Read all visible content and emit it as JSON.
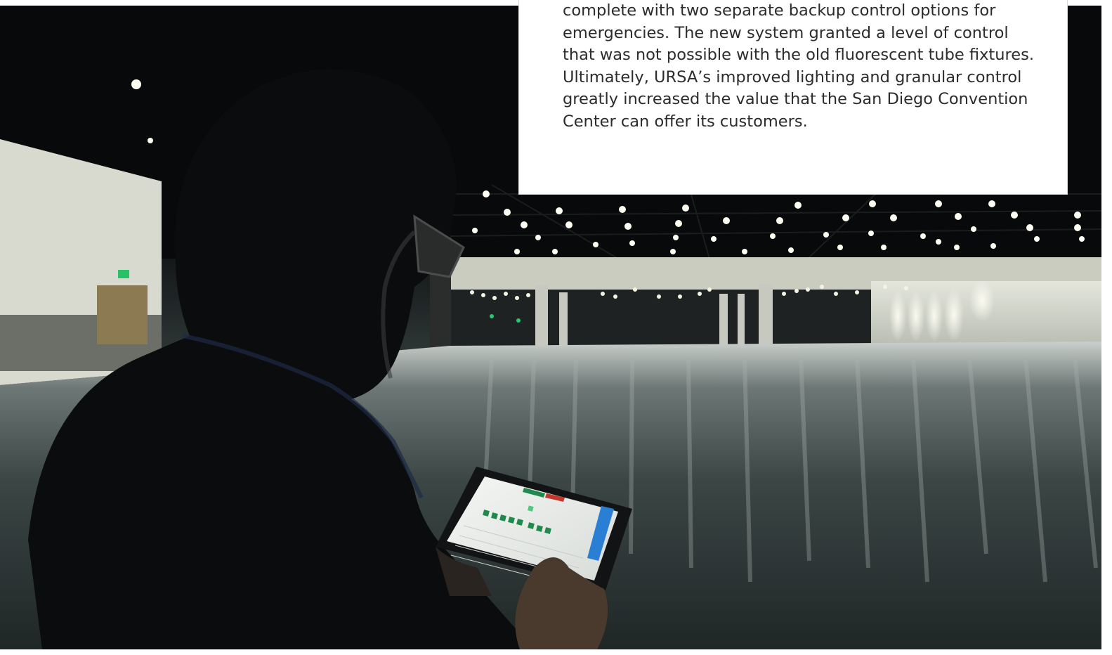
{
  "article": {
    "paragraph": "complete with two separate backup control options for\nemergencies. The new system granted a level of control\nthat was not possible with the old fluorescent tube fixtures.\nUltimately, URSA’s improved lighting and granular control\ngreatly increased the value that the San Diego Convention\nCenter can offer its customers."
  },
  "photo": {
    "subject": "person-with-tablet",
    "scene": "convention-hall-lighting"
  },
  "colors": {
    "text": "#2c2c2c",
    "card_background": "#ffffff",
    "tablet_button_green": "#1f8a4c",
    "tablet_accent_blue": "#2a7fd4"
  }
}
